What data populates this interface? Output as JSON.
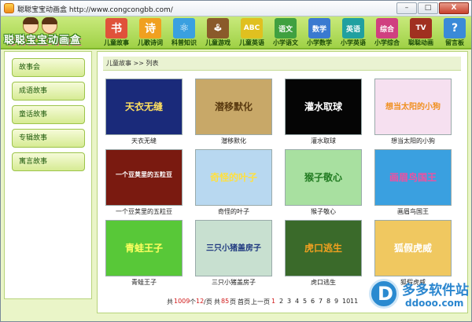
{
  "window": {
    "title": "聪聪宝宝动画盒 http://www.congcongbb.com/",
    "min_label": "–",
    "max_label": "□",
    "close_label": "X"
  },
  "logo": {
    "text": "聪聪宝宝动画盒"
  },
  "nav": [
    {
      "label": "儿童故事",
      "glyph": "书",
      "color": "#e0523a"
    },
    {
      "label": "儿歌诗词",
      "glyph": "诗",
      "color": "#f0a020"
    },
    {
      "label": "科普知识",
      "glyph": "⚛",
      "color": "#3aa0e0"
    },
    {
      "label": "儿童游戏",
      "glyph": "🕹",
      "color": "#8a5a2a"
    },
    {
      "label": "儿童英语",
      "glyph": "ABC",
      "color": "#e0c020"
    },
    {
      "label": "小学语文",
      "glyph": "语文",
      "color": "#40a040"
    },
    {
      "label": "小学数学",
      "glyph": "数学",
      "color": "#3a7ad0"
    },
    {
      "label": "小学英语",
      "glyph": "英语",
      "color": "#20a0a0"
    },
    {
      "label": "小学综合",
      "glyph": "综合",
      "color": "#d04080"
    },
    {
      "label": "聪聪动画",
      "glyph": "TV",
      "color": "#a03020"
    },
    {
      "label": "留言板",
      "glyph": "?",
      "color": "#3a8ad8"
    }
  ],
  "sidebar": {
    "items": [
      "故事会",
      "成语故事",
      "童话故事",
      "专辑故事",
      "寓言故事"
    ]
  },
  "breadcrumb": "儿童故事 >> 列表",
  "cards": [
    {
      "title": "天衣无缝",
      "thumb_text": "天衣无缝",
      "bg": "#1a2a7a",
      "fg": "#ffe060"
    },
    {
      "title": "潜移默化",
      "thumb_text": "潜移默化",
      "bg": "#c8a868",
      "fg": "#5a3a10"
    },
    {
      "title": "灌水取球",
      "thumb_text": "灌水取球",
      "bg": "#050505",
      "fg": "#ffffff"
    },
    {
      "title": "想当太阳的小狗",
      "thumb_text": "想当太阳的小狗",
      "bg": "#f6e0f0",
      "fg": "#f09020"
    },
    {
      "title": "一个豆荚里的五粒豆",
      "thumb_text": "一个豆荚里的五粒豆",
      "bg": "#7a1a10",
      "fg": "#ffffff"
    },
    {
      "title": "奇怪的叶子",
      "thumb_text": "奇怪的叶子",
      "bg": "#b8d8f0",
      "fg": "#ffe040"
    },
    {
      "title": "猴子敬心",
      "thumb_text": "猴子敬心",
      "bg": "#a8e0a0",
      "fg": "#207a20"
    },
    {
      "title": "画眉鸟国王",
      "thumb_text": "画眉鸟国王",
      "bg": "#3aa0e0",
      "fg": "#f050a0"
    },
    {
      "title": "青蛙王子",
      "thumb_text": "青蛙王子",
      "bg": "#58c838",
      "fg": "#ffff60"
    },
    {
      "title": "三只小猪盖房子",
      "thumb_text": "三只小猪盖房子",
      "bg": "#c8e0d0",
      "fg": "#203a80"
    },
    {
      "title": "虎口逃生",
      "thumb_text": "虎口逃生",
      "bg": "#3a6a2a",
      "fg": "#f0a020"
    },
    {
      "title": "狐假虎威",
      "thumb_text": "狐假虎威",
      "bg": "#f0c860",
      "fg": "#ffffff"
    }
  ],
  "pager": {
    "total_prefix": "共",
    "total_count": "1009",
    "total_suffix": "个",
    "per_page": "12",
    "per_label": "/页",
    "pages_prefix": "共",
    "pages_count": "85",
    "pages_suffix": "页",
    "first": "首页",
    "prev": "上一页",
    "current": "1",
    "pages": [
      "2",
      "3",
      "4",
      "5",
      "6",
      "7",
      "8",
      "9",
      "10",
      "11"
    ]
  },
  "watermark": {
    "cn": "多多软件站",
    "en": "ddooo.com",
    "mark": "D"
  }
}
